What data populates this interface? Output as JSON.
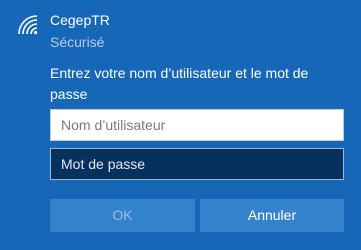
{
  "network": {
    "icon": "wifi-icon",
    "name": "CegepTR",
    "status": "Sécurisé"
  },
  "prompt": "Entrez votre nom d’utilisateur et le mot de passe",
  "username_field": {
    "placeholder": "Nom d’utilisateur",
    "value": ""
  },
  "password_field": {
    "placeholder": "Mot de passe",
    "value": ""
  },
  "buttons": {
    "ok_label": "OK",
    "ok_enabled": false,
    "cancel_label": "Annuler"
  },
  "colors": {
    "background": "#1767b8",
    "button": "#3582cc",
    "password_field_bg": "#06315d"
  }
}
